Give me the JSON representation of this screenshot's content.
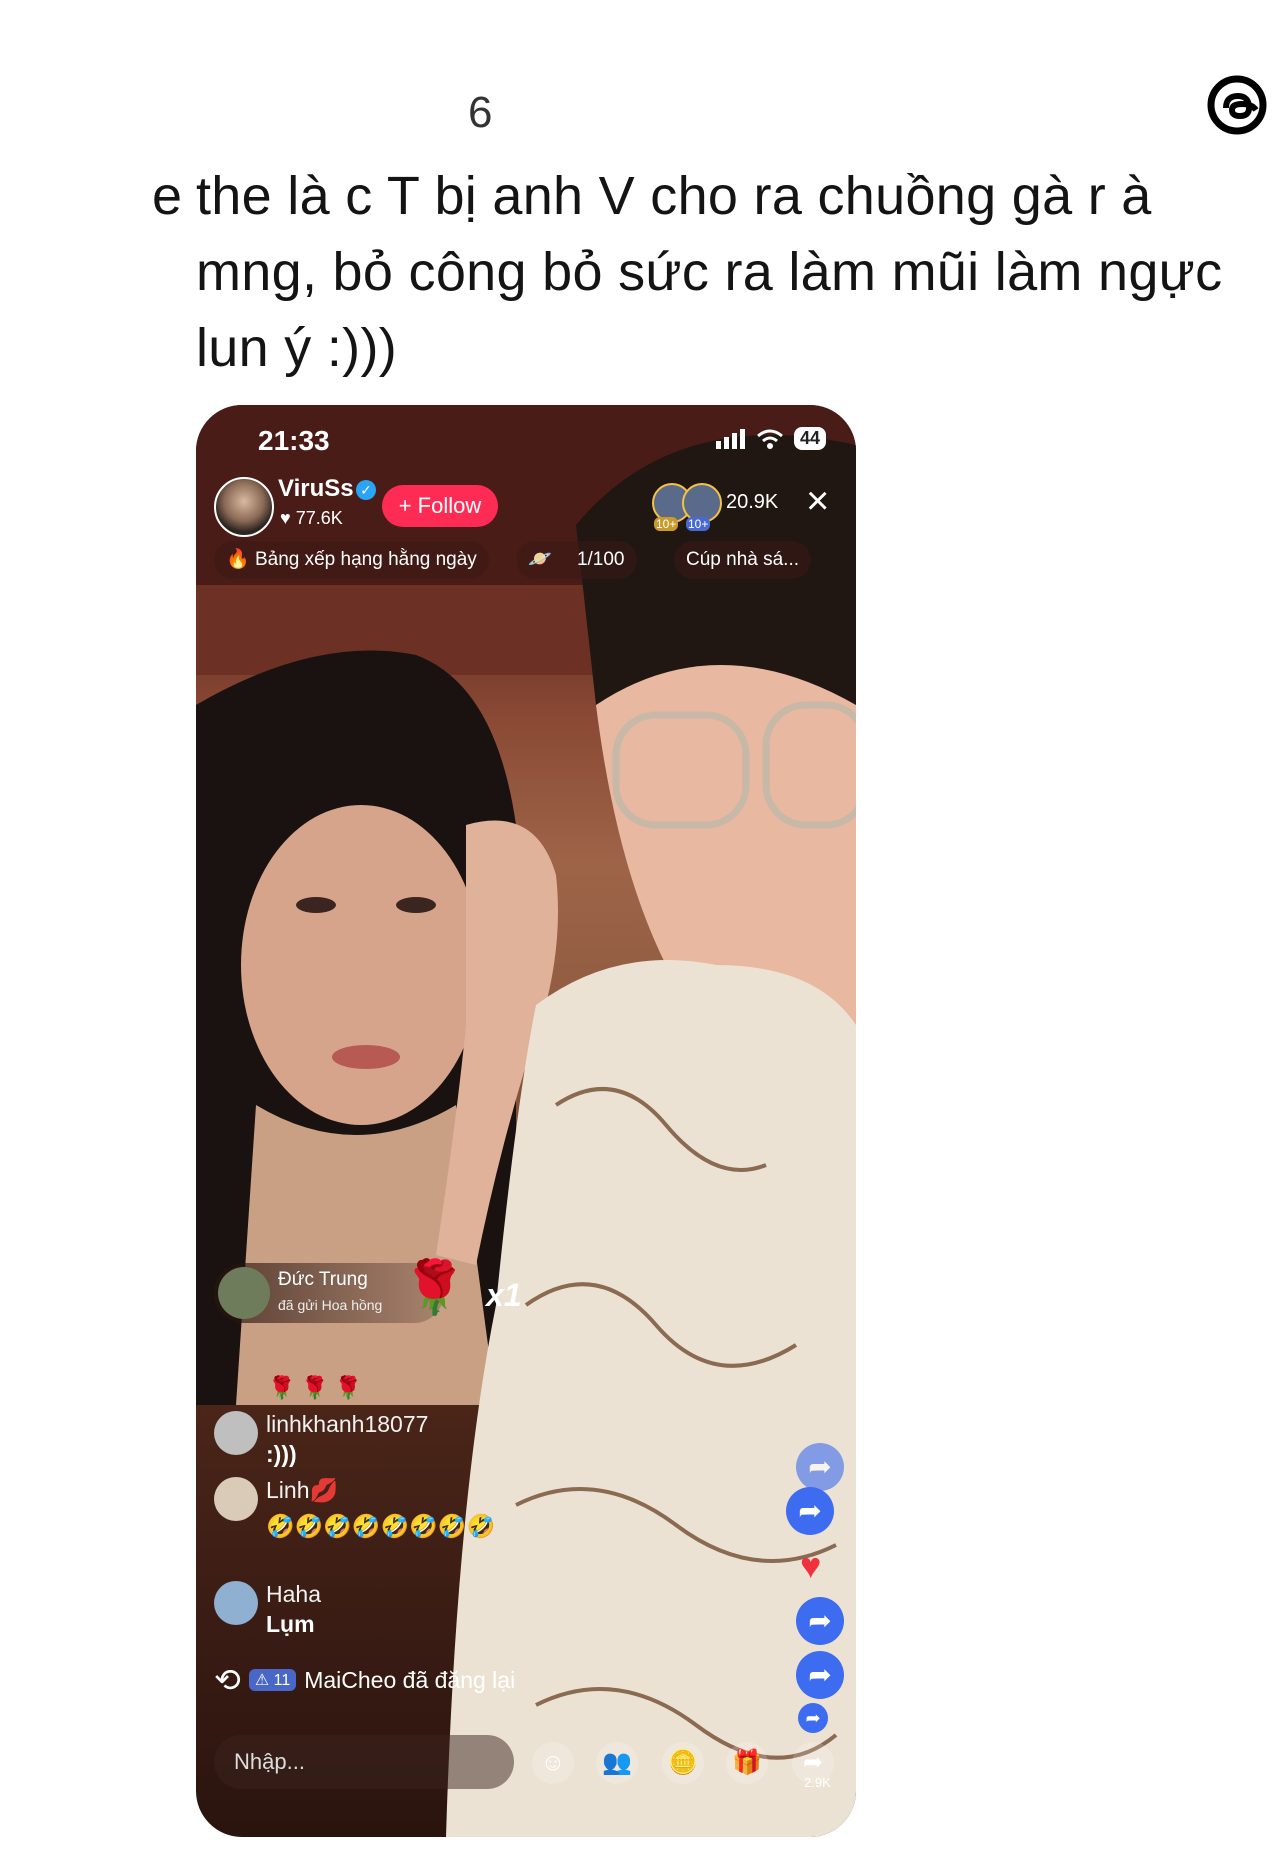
{
  "post": {
    "header_digit": "6",
    "lead": "e",
    "text": "the là c T bị anh V cho ra chuồng gà r à mng, bỏ công bỏ sức ra làm mũi làm ngực lun ý :)))"
  },
  "live": {
    "status": {
      "time": "21:33",
      "battery": "44"
    },
    "host": {
      "name": "ViruSs",
      "likes": "77.6K",
      "follow_label": "+ Follow"
    },
    "viewers": {
      "badge_1": "10+",
      "badge_2": "10+",
      "count": "20.9K"
    },
    "close_label": "×",
    "pills": {
      "ranking": "Bảng xếp hạng hằng ngày",
      "progress": "1/100",
      "cup": "Cúp nhà sá..."
    },
    "gift": {
      "sender": "Đức Trung",
      "message": "đã gửi Hoa hồng",
      "multiplier": "x1",
      "rose": "🌹"
    },
    "roses_row": "🌹🌹🌹",
    "comments": [
      {
        "user": "linhkhanh18077",
        "text": ":)))"
      },
      {
        "user": "Linh💋",
        "text": "🤣🤣🤣🤣🤣🤣🤣🤣"
      },
      {
        "user": "Haha",
        "text": "Lụm"
      }
    ],
    "repost": {
      "badge": "⚠ 11",
      "text": "MaiCheo đã đăng lại"
    },
    "input_placeholder": "Nhập...",
    "share_count": "2.9K"
  }
}
